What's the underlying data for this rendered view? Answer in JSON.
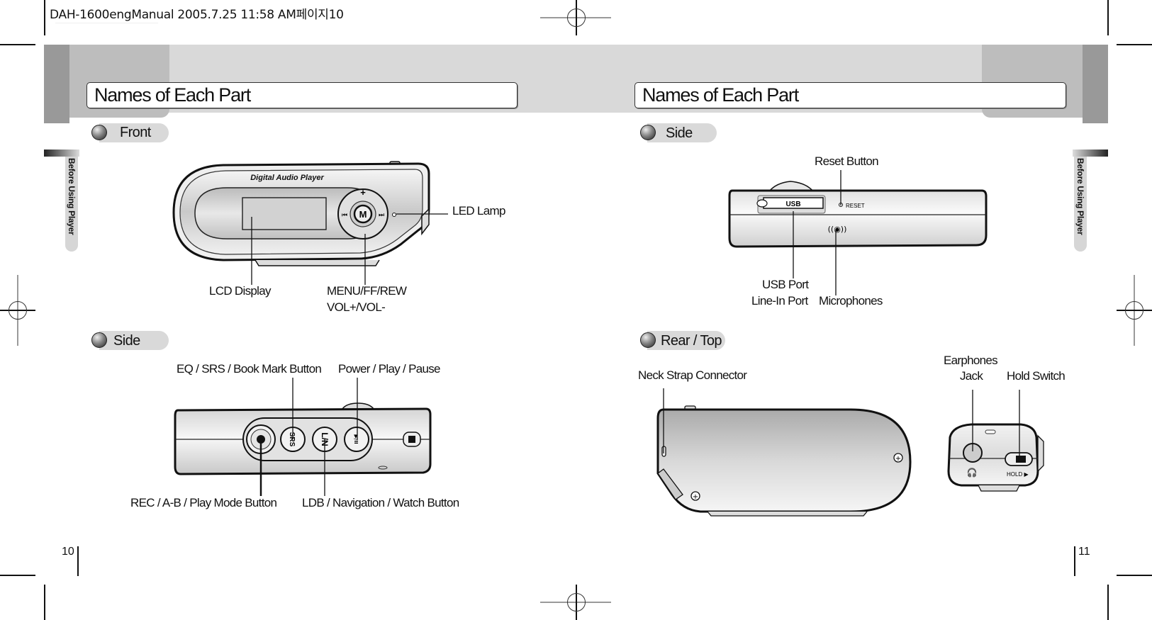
{
  "slug_line": "DAH-1600engManual  2005.7.25 11:58 AM페이지10",
  "section_tab": "Before Using Player",
  "left_page": {
    "title": "Names of Each Part",
    "page_number": "10",
    "front": {
      "heading": "Front",
      "device_brand_text": "Digital Audio Player",
      "center_button_glyph": "M",
      "labels": {
        "led": "LED Lamp",
        "lcd": "LCD Display",
        "menu_line1": "MENU/FF/REW",
        "menu_line2": "VOL+/VOL-"
      }
    },
    "side": {
      "heading": "Side",
      "button_glyphs": [
        "●",
        "SRS",
        "L/N",
        "▶/II"
      ],
      "labels": {
        "eq": "EQ / SRS / Book Mark Button",
        "power": "Power / Play / Pause",
        "rec": "REC / A-B / Play Mode Button",
        "ldb": "LDB / Navigation / Watch Button"
      }
    }
  },
  "right_page": {
    "title": "Names of Each Part",
    "page_number": "11",
    "side": {
      "heading": "Side",
      "usb_text": "USB",
      "reset_text": "RESET",
      "labels": {
        "reset": "Reset Button",
        "usb_line1": "USB Port",
        "usb_line2": "Line-In Port",
        "mic": "Microphones"
      }
    },
    "rear_top": {
      "heading": "Rear / Top",
      "hold_text": "HOLD ▶",
      "labels": {
        "neck": "Neck Strap Connector",
        "earphones_line1": "Earphones",
        "earphones_line2": "Jack",
        "hold": "Hold Switch"
      }
    }
  }
}
